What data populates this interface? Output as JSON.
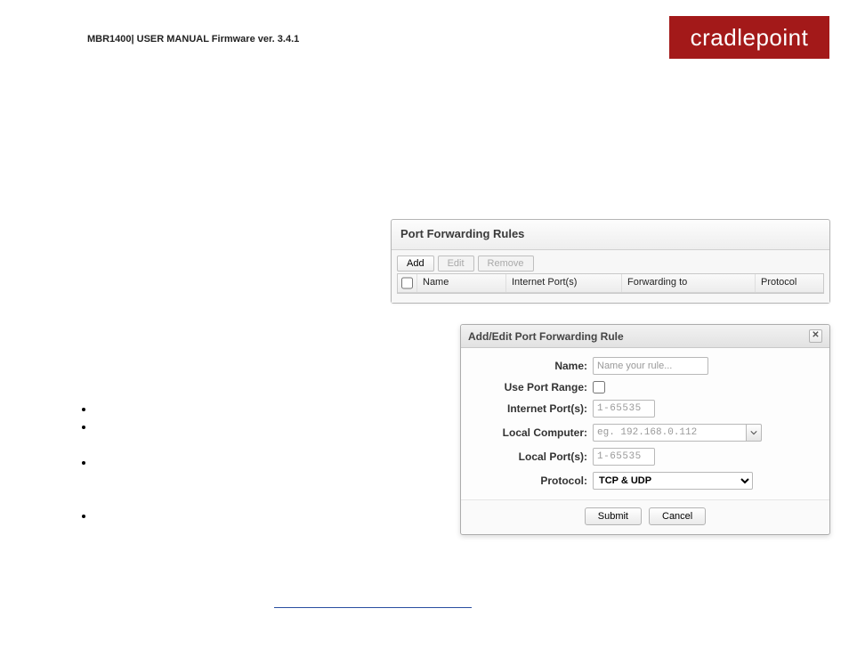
{
  "header_text": "MBR1400| USER MANUAL Firmware ver. 3.4.1",
  "brand": "cradlepoint",
  "rules_panel": {
    "title": "Port Forwarding Rules",
    "toolbar": {
      "add": "Add",
      "edit": "Edit",
      "remove": "Remove"
    },
    "columns": {
      "name": "Name",
      "internet_ports": "Internet Port(s)",
      "forwarding_to": "Forwarding to",
      "protocol": "Protocol"
    }
  },
  "dialog": {
    "title": "Add/Edit Port Forwarding Rule",
    "labels": {
      "name": "Name:",
      "use_port_range": "Use Port Range:",
      "internet_ports": "Internet Port(s):",
      "local_computer": "Local Computer:",
      "local_ports": "Local Port(s):",
      "protocol": "Protocol:"
    },
    "placeholders": {
      "name": "Name your rule...",
      "port": "1-65535",
      "local_computer": "eg. 192.168.0.112"
    },
    "protocol_value": "TCP & UDP",
    "buttons": {
      "submit": "Submit",
      "cancel": "Cancel"
    }
  }
}
